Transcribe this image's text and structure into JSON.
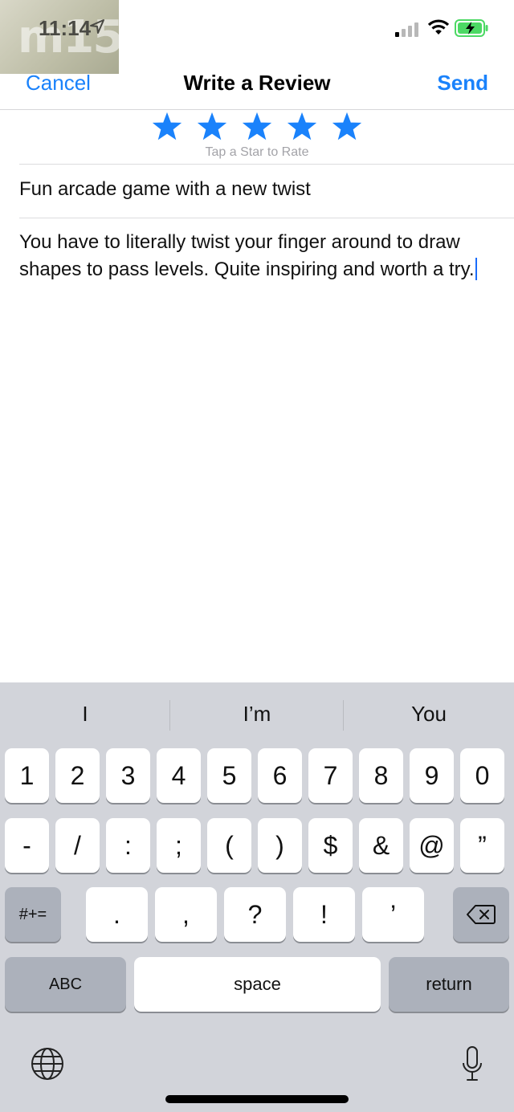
{
  "status_bar": {
    "time": "11:14",
    "watermark": "m15"
  },
  "nav": {
    "cancel": "Cancel",
    "title": "Write a Review",
    "send": "Send"
  },
  "rating": {
    "stars": 5,
    "max": 5,
    "hint": "Tap a Star to Rate",
    "color": "#1a82fb"
  },
  "review": {
    "title": "Fun arcade game with a new twist",
    "body": "You have to literally twist your finger around to draw shapes to pass levels. Quite inspiring and worth a try."
  },
  "keyboard": {
    "suggestions": [
      "I",
      "I’m",
      "You"
    ],
    "row1": [
      "1",
      "2",
      "3",
      "4",
      "5",
      "6",
      "7",
      "8",
      "9",
      "0"
    ],
    "row2": [
      "-",
      "/",
      ":",
      ";",
      "(",
      ")",
      "$",
      "&",
      "@",
      "”"
    ],
    "row3_left": "#+=",
    "row3": [
      ".",
      ",",
      "?",
      "!",
      "’"
    ],
    "abc": "ABC",
    "space": "space",
    "return": "return"
  },
  "icons": {
    "backspace": "delete-key-icon",
    "globe": "globe-icon",
    "mic": "microphone-icon"
  }
}
